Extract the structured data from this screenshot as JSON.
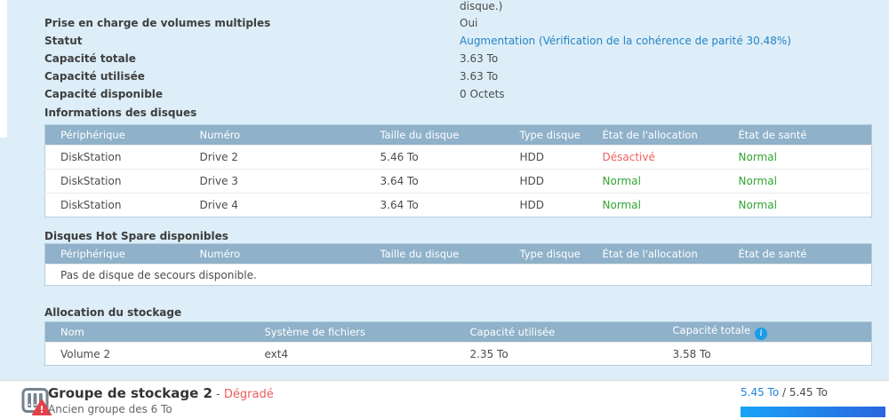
{
  "colors": {
    "panel_bg": "#ddeef8",
    "table_header_bg": "#8fb1ca",
    "status_link_blue": "#2483c5",
    "error_red": "#f05f5f",
    "ok_green": "#33a333",
    "degraded_red": "#ee5a5a",
    "capacity_used_blue": "#2284d8",
    "progress_gradient_start": "#18a3f7",
    "progress_gradient_end": "#2a65e0"
  },
  "overview": {
    "truncated_text": "disque.)",
    "multi_volume_label": "Prise en charge de volumes multiples",
    "multi_volume_value": "Oui",
    "status_label": "Statut",
    "status_value": "Augmentation (Vérification de la cohérence de parité 30.48%)",
    "total_label": "Capacité totale",
    "total_value": "3.63 To",
    "used_label": "Capacité utilisée",
    "used_value": "3.63 To",
    "available_label": "Capacité disponible",
    "available_value": "0 Octets"
  },
  "disk_info": {
    "title": "Informations des disques",
    "headers": [
      "Périphérique",
      "Numéro",
      "Taille du disque",
      "Type disque",
      "État de l'allocation",
      "État de santé"
    ],
    "rows": [
      {
        "device": "DiskStation",
        "number": "Drive 2",
        "size": "5.46 To",
        "type": "HDD",
        "allocation": "Désactivé",
        "allocation_color": "#f05f5f",
        "health": "Normal",
        "health_color": "#33a333"
      },
      {
        "device": "DiskStation",
        "number": "Drive 3",
        "size": "3.64 To",
        "type": "HDD",
        "allocation": "Normal",
        "allocation_color": "#33a333",
        "health": "Normal",
        "health_color": "#33a333"
      },
      {
        "device": "DiskStation",
        "number": "Drive 4",
        "size": "3.64 To",
        "type": "HDD",
        "allocation": "Normal",
        "allocation_color": "#33a333",
        "health": "Normal",
        "health_color": "#33a333"
      }
    ]
  },
  "hot_spare": {
    "title": "Disques Hot Spare disponibles",
    "headers": [
      "Périphérique",
      "Numéro",
      "Taille du disque",
      "Type disque",
      "État de l'allocation",
      "État de santé"
    ],
    "empty_message": "Pas de disque de secours disponible."
  },
  "allocation": {
    "title": "Allocation du stockage",
    "headers": [
      "Nom",
      "Système de fichiers",
      "Capacité utilisée",
      "Capacité totale"
    ],
    "info_glyph": "i",
    "rows": [
      {
        "name": "Volume 2",
        "filesystem": "ext4",
        "used": "2.35 To",
        "total": "3.58 To"
      }
    ]
  },
  "footer": {
    "title": "Groupe de stockage 2",
    "separator": " - ",
    "status": "Dégradé",
    "subtitle": "Ancien groupe des 6 To",
    "capacity_used": "5.45 To",
    "capacity_total": " / 5.45 To",
    "progress_width": "100%"
  }
}
